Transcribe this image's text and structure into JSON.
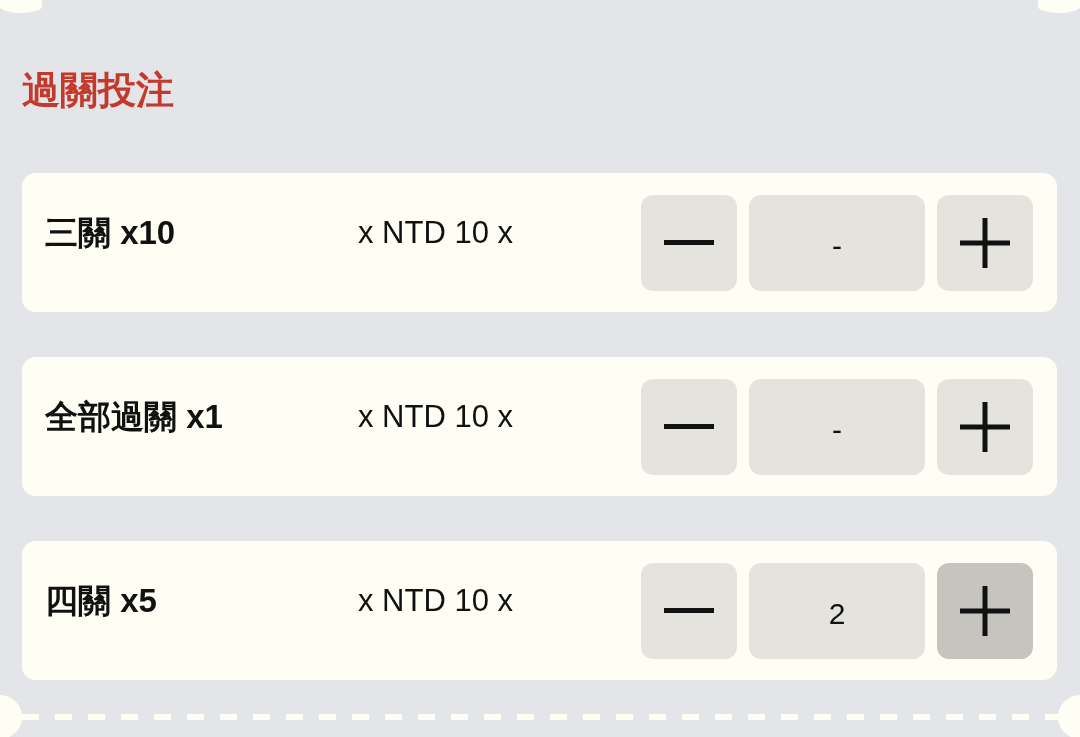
{
  "section": {
    "title": "過關投注"
  },
  "bets": [
    {
      "label": "三關 x10",
      "stake": "x NTD 10 x",
      "quantity": "-",
      "plus_pressed": false
    },
    {
      "label": "全部過關 x1",
      "stake": "x NTD 10 x",
      "quantity": "-",
      "plus_pressed": false
    },
    {
      "label": "四關 x5",
      "stake": "x NTD 10 x",
      "quantity": "2",
      "plus_pressed": true
    }
  ]
}
